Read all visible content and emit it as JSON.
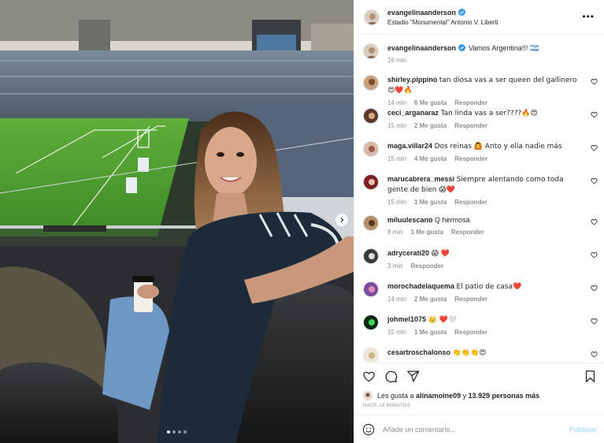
{
  "post": {
    "username": "evangelinaanderson",
    "location": "Estadio \"Monumental\" Antonio V. Liberti",
    "more_icon": "more-horizontal-icon",
    "carousel": {
      "count": 4,
      "active": 0
    }
  },
  "caption": {
    "username": "evangelinaanderson",
    "text": "Vamos Argentina!!! 🇦🇷",
    "time": "16 min"
  },
  "comments": [
    {
      "username": "shirley.pippino",
      "text": "tan diosa vas a ser queen del gallinero 😍❤️🔥",
      "time": "14 min",
      "likes": "6 Me gusta",
      "reply": "Responder"
    },
    {
      "username": "ceci_arganaraz",
      "text": "Tan linda vas a ser????🔥😍",
      "time": "15 min",
      "likes": "2 Me gusta",
      "reply": "Responder"
    },
    {
      "username": "maga.villar24",
      "text": "Dos reinas 🙆 Anto y ella nadie más",
      "time": "15 min",
      "likes": "4 Me gusta",
      "reply": "Responder"
    },
    {
      "username": "marucabrera_messi",
      "text": "Siempre alentando como toda gente de bien 😱❤️",
      "time": "15 min",
      "likes": "1 Me gusta",
      "reply": "Responder"
    },
    {
      "username": "miluulescano",
      "text": "Q hermosa",
      "time": "8 min",
      "likes": "1 Me gusta",
      "reply": "Responder"
    },
    {
      "username": "adryceratí20",
      "text": "😱 ❤️",
      "time": "3 min",
      "likes": "",
      "reply": "Responder"
    },
    {
      "username": "morochadelaquema",
      "text": "El patio de casa❤️",
      "time": "14 min",
      "likes": "2 Me gusta",
      "reply": "Responder"
    },
    {
      "username": "johmel1075",
      "text": "👑 ❤️🤍",
      "time": "15 min",
      "likes": "1 Me gusta",
      "reply": "Responder"
    },
    {
      "username": "cesartroschalonso",
      "text": "👏👏👏😍",
      "time": "",
      "likes": "",
      "reply": ""
    }
  ],
  "actions": {
    "like_icon": "heart-outline-icon",
    "comment_icon": "comment-bubble-icon",
    "share_icon": "paper-plane-icon",
    "save_icon": "bookmark-icon"
  },
  "likes": {
    "prefix": "Les gusta a",
    "user": "alinamoine09",
    "middle": "y",
    "count": "13.929 personas más"
  },
  "timestamp": "HACE 16 MINUTOS",
  "add_comment": {
    "placeholder": "Añade un comentario...",
    "publish": "Publicar",
    "emoji_icon": "smiley-icon"
  },
  "colors": {
    "verified": "#3897f0",
    "muted": "#8e8e8e",
    "publish_disabled": "#b2dffc",
    "heart_red": "#ed4956"
  }
}
